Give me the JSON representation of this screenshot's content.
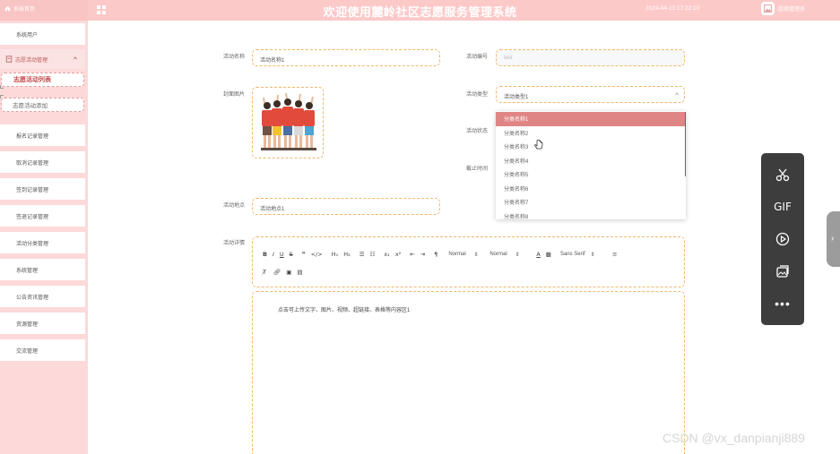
{
  "header": {
    "home_label": "系统首页",
    "title": "欢迎使用麓岭社区志愿服务管理系统",
    "time": "2024-04-13 17:22:10",
    "user_name": "超级管理员"
  },
  "sidebar": {
    "items_top": [
      {
        "label": "系统用户"
      }
    ],
    "group": {
      "label": "志愿活动管理"
    },
    "submenu": [
      {
        "label": "志愿活动列表",
        "active": true
      },
      {
        "label": "志愿活动添加",
        "active": false
      }
    ],
    "items": [
      {
        "label": "报名记录管理"
      },
      {
        "label": "取消记录管理"
      },
      {
        "label": "签到记录管理"
      },
      {
        "label": "签退记录管理"
      },
      {
        "label": "活动分类管理"
      },
      {
        "label": "系统管理"
      },
      {
        "label": "公告资讯管理"
      },
      {
        "label": "资源管理"
      },
      {
        "label": "交流管理"
      }
    ]
  },
  "form": {
    "name_label": "活动名称",
    "name_value": "活动名称1",
    "code_label": "活动编号",
    "code_placeholder": "test",
    "cover_label": "封面图片",
    "type_label": "活动类型",
    "type_value": "活动类型1",
    "status_label": "活动状态",
    "deadline_label": "截止时间",
    "address_label": "活动地点",
    "address_value": "活动地点1",
    "detail_label": "活动详情"
  },
  "dropdown": {
    "options": [
      "分类名称1",
      "分类名称2",
      "分类名称3",
      "分类名称4",
      "分类名称5",
      "分类名称6",
      "分类名称7",
      "分类名称8"
    ],
    "selected_index": 0
  },
  "editor": {
    "header_select": "Normal",
    "size_select": "Normal",
    "font_select": "Sans Serif",
    "placeholder": "点击可上传文字、图片、视频、超链接、表格等内容区1"
  },
  "watermark": "CSDN @vx_danpianji889",
  "colors": {
    "header_bg": "#fcc9c9",
    "sidebar_bg": "#fdd9d9",
    "accent": "#e08585",
    "input_border": "#f3b66d"
  }
}
